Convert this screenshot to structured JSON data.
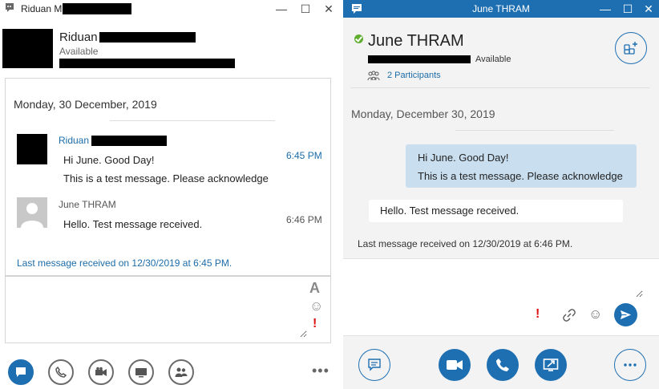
{
  "left_window": {
    "title": "Riduan M",
    "contact": {
      "name": "Riduan",
      "status": "Available"
    },
    "conversation": {
      "date": "Monday, 30 December, 2019",
      "messages": [
        {
          "sender": "Riduan",
          "lines": [
            "Hi June. Good Day!",
            "This is a test message. Please acknowledge"
          ],
          "time": "6:45 PM"
        },
        {
          "sender": "June THRAM",
          "lines": [
            "Hello. Test message received."
          ],
          "time": "6:46 PM"
        }
      ],
      "last_received": "Last message received on 12/30/2019 at 6:45 PM."
    },
    "compose": {
      "font_tool": "A",
      "emoji_tool": "☺",
      "importance_tool": "!"
    },
    "footer": {
      "more": "•••"
    }
  },
  "right_window": {
    "title": "June THRAM",
    "contact": {
      "name": "June THRAM",
      "status": "Available",
      "participants": "2 Participants"
    },
    "conversation": {
      "date": "Monday, December 30, 2019",
      "sent": [
        "Hi June. Good Day!",
        "This is a test message. Please acknowledge"
      ],
      "received": [
        "Hello. Test message received."
      ],
      "last_received": "Last message received on 12/30/2019 at 6:46 PM."
    },
    "compose": {
      "importance_tool": "!",
      "emoji_tool": "☺"
    }
  },
  "colors": {
    "accent": "#1e6fb2",
    "link": "#1c6ca8",
    "presence_available": "#5fae2f",
    "sent_bubble": "#c9dff0",
    "important": "#dd1111"
  },
  "icons": {
    "left_titlebar": "im-window-icon",
    "right_titlebar": "chat-bubble-icon",
    "left_footer": [
      "im-icon",
      "phone-icon",
      "video-icon",
      "present-icon",
      "people-icon"
    ],
    "right_footer": [
      "im-icon",
      "video-icon",
      "phone-icon",
      "present-icon",
      "more-options-icon"
    ]
  }
}
